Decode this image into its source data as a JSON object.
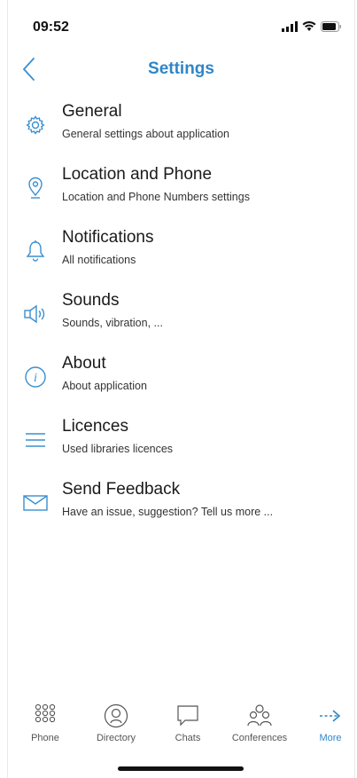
{
  "status_bar": {
    "time": "09:52"
  },
  "nav": {
    "title": "Settings"
  },
  "colors": {
    "accent": "#2f86c8",
    "icon": "#3a8fd0"
  },
  "settings": [
    {
      "icon": "gear-icon",
      "label": "General",
      "sub": "General settings about application"
    },
    {
      "icon": "location-pin-icon",
      "label": "Location and Phone",
      "sub": "Location and Phone Numbers settings"
    },
    {
      "icon": "bell-icon",
      "label": "Notifications",
      "sub": "All notifications"
    },
    {
      "icon": "speaker-icon",
      "label": "Sounds",
      "sub": "Sounds, vibration, ..."
    },
    {
      "icon": "info-icon",
      "label": "About",
      "sub": "About application"
    },
    {
      "icon": "list-icon",
      "label": "Licences",
      "sub": "Used libraries licences"
    },
    {
      "icon": "envelope-icon",
      "label": "Send Feedback",
      "sub": "Have an issue, suggestion? Tell us more ..."
    }
  ],
  "tabs": [
    {
      "icon": "keypad-icon",
      "label": "Phone"
    },
    {
      "icon": "contact-icon",
      "label": "Directory"
    },
    {
      "icon": "chat-bubble-icon",
      "label": "Chats"
    },
    {
      "icon": "group-icon",
      "label": "Conferences"
    },
    {
      "icon": "arrow-right-icon",
      "label": "More",
      "active": true
    }
  ]
}
